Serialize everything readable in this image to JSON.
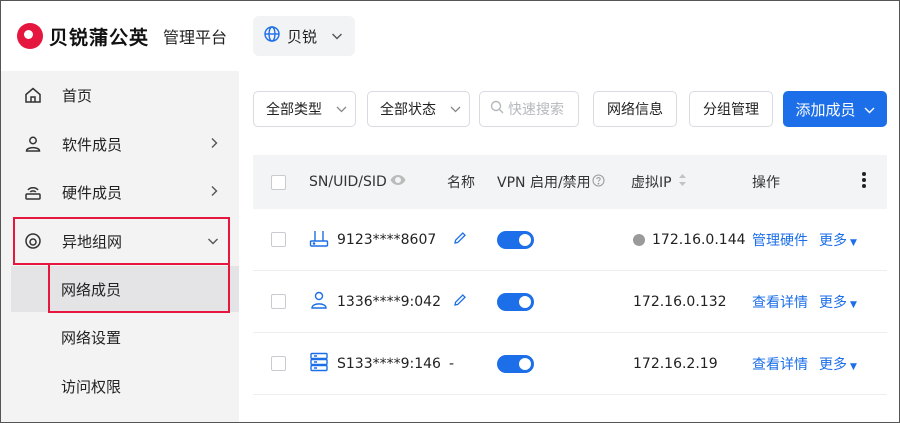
{
  "brand": {
    "name": "贝锐蒲公英",
    "subtitle": "管理平台"
  },
  "sidebar": {
    "items": [
      {
        "label": "首页"
      },
      {
        "label": "软件成员"
      },
      {
        "label": "硬件成员"
      },
      {
        "label": "异地组网"
      }
    ],
    "subitems": [
      {
        "label": "网络成员"
      },
      {
        "label": "网络设置"
      },
      {
        "label": "访问权限"
      }
    ]
  },
  "topbar": {
    "org_label": "贝锐"
  },
  "toolbar": {
    "type_filter": "全部类型",
    "status_filter": "全部状态",
    "search_placeholder": "快速搜索",
    "network_info": "网络信息",
    "group_manage": "分组管理",
    "add_member": "添加成员"
  },
  "table": {
    "columns": {
      "id": "SN/UID/SID",
      "name": "名称",
      "vpn": "VPN 启用/禁用",
      "ip": "虚拟IP",
      "actions": "操作"
    },
    "rows": [
      {
        "type_icon": "router-icon",
        "id": "9123****8607",
        "name_icon": "pencil-icon",
        "name": "",
        "vpn_enabled": true,
        "ip": "172.16.0.144",
        "offline": true,
        "action": "管理硬件",
        "more": "更多"
      },
      {
        "type_icon": "user-icon",
        "id": "1336****9:042",
        "name_icon": "pencil-icon",
        "name": "",
        "vpn_enabled": true,
        "ip": "172.16.0.132",
        "offline": false,
        "action": "查看详情",
        "more": "更多"
      },
      {
        "type_icon": "server-icon",
        "id": "S133****9:146",
        "name_icon": "",
        "name": "-",
        "vpn_enabled": true,
        "ip": "172.16.2.19",
        "offline": false,
        "action": "查看详情",
        "more": "更多"
      }
    ]
  },
  "colors": {
    "brand_red": "#e5173f",
    "primary_blue": "#1c6fe8",
    "active_bg": "#e4e4e7"
  }
}
